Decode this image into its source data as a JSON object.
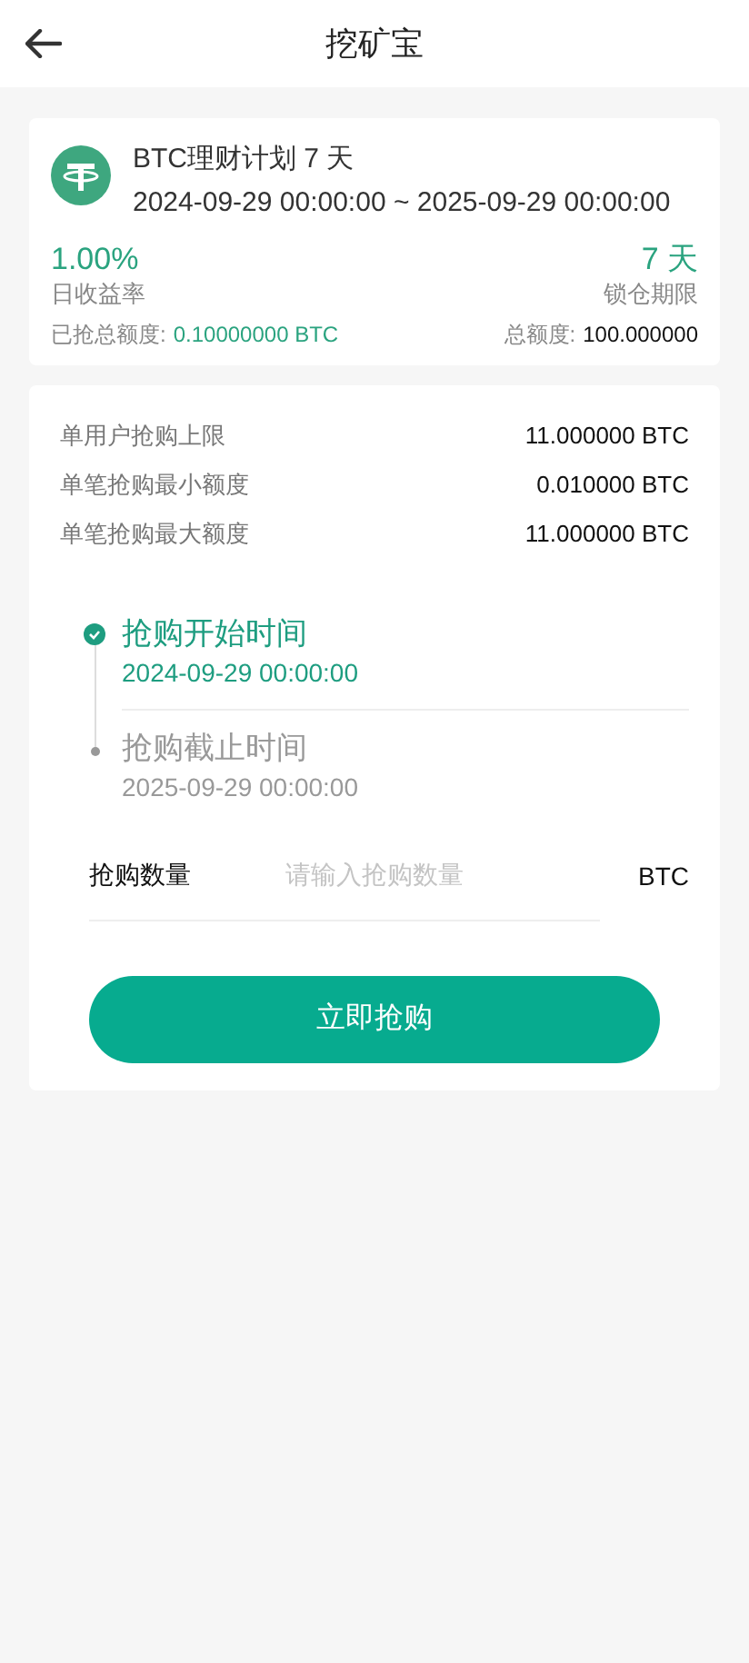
{
  "header": {
    "title": "挖矿宝"
  },
  "plan": {
    "name": "BTC理财计划 7 天",
    "period": "2024-09-29 00:00:00 ~ 2025-09-29 00:00:00",
    "rate": "1.00%",
    "rate_label": "日收益率",
    "lock": "7 天",
    "lock_label": "锁仓期限",
    "sold_label": "已抢总额度:",
    "sold_value": "0.10000000 BTC",
    "total_label": "总额度:",
    "total_value": "100.000000"
  },
  "limits": [
    {
      "label": "单用户抢购上限",
      "value": "11.000000 BTC"
    },
    {
      "label": "单笔抢购最小额度",
      "value": "0.010000 BTC"
    },
    {
      "label": "单笔抢购最大额度",
      "value": "11.000000 BTC"
    }
  ],
  "timeline": [
    {
      "title": "抢购开始时间",
      "time": "2024-09-29 00:00:00",
      "completed": true
    },
    {
      "title": "抢购截止时间",
      "time": "2025-09-29 00:00:00",
      "completed": false
    }
  ],
  "amount": {
    "label": "抢购数量",
    "placeholder": "请输入抢购数量",
    "unit": "BTC"
  },
  "submit": "立即抢购"
}
